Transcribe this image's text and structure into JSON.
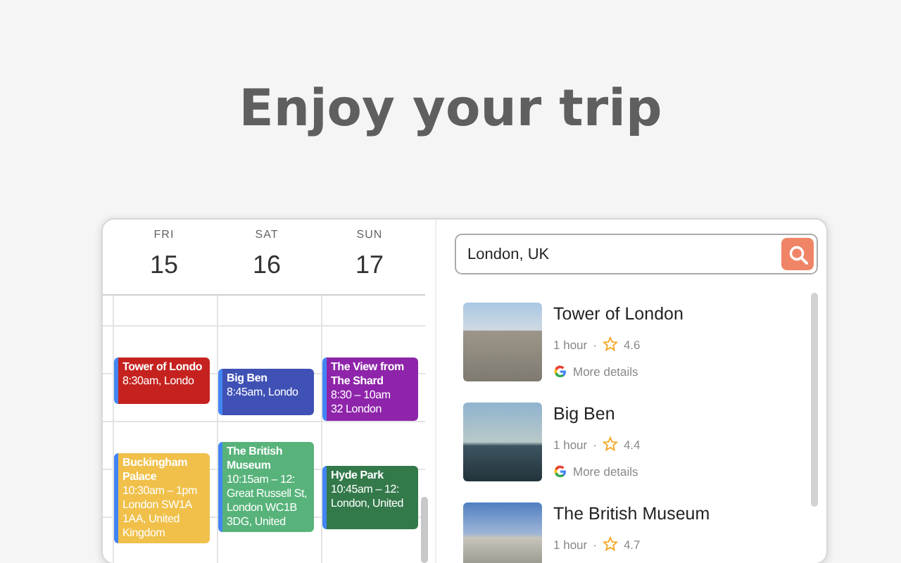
{
  "heading": "Enjoy your trip",
  "calendar": {
    "days": [
      {
        "weekday": "FRI",
        "date": "15",
        "events": [
          {
            "title": "Tower of Londo",
            "lines": [
              "8:30am, Londo"
            ],
            "color": "#c5221f"
          },
          {
            "title": "Buckingham Palace",
            "lines": [
              "10:30am – 1pm",
              "London SW1A 1AA, United Kingdom"
            ],
            "color": "#f0c04a"
          }
        ]
      },
      {
        "weekday": "SAT",
        "date": "16",
        "events": [
          {
            "title": "Big Ben",
            "lines": [
              "8:45am, Londo"
            ],
            "color": "#3f51b5"
          },
          {
            "title": "The British Museum",
            "lines": [
              "10:15am – 12:",
              "Great Russell St, London WC1B 3DG, United"
            ],
            "color": "#57b37a"
          }
        ]
      },
      {
        "weekday": "SUN",
        "date": "17",
        "events": [
          {
            "title": "The View from The Shard",
            "lines": [
              "8:30 – 10am",
              "32 London"
            ],
            "color": "#8e24aa"
          },
          {
            "title": "Hyde Park",
            "lines": [
              "10:45am – 12:",
              "London, United"
            ],
            "color": "#33794a"
          }
        ]
      }
    ]
  },
  "search": {
    "value": "London, UK"
  },
  "places": [
    {
      "name": "Tower of London",
      "duration": "1 hour",
      "separator": "·",
      "rating": "4.6",
      "link": "More details"
    },
    {
      "name": "Big Ben",
      "duration": "1 hour",
      "separator": "·",
      "rating": "4.4",
      "link": "More details"
    },
    {
      "name": "The British Museum",
      "duration": "1 hour",
      "separator": "·",
      "rating": "4.7"
    }
  ]
}
